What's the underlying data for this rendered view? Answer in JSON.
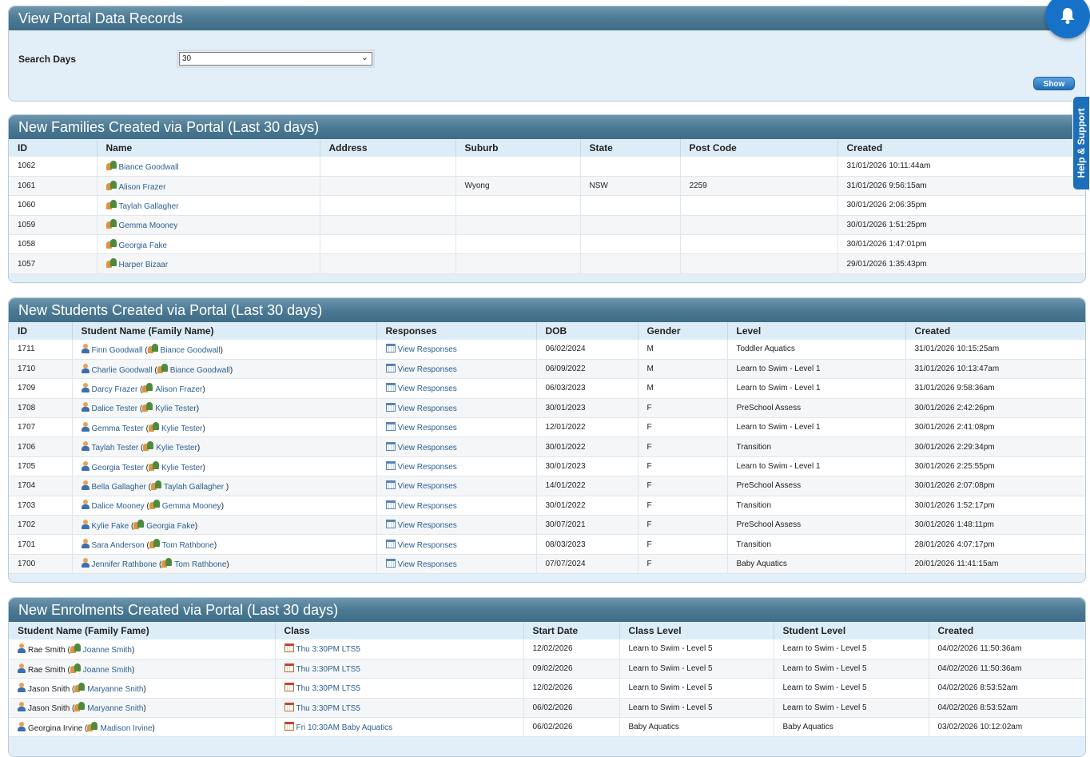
{
  "search_panel": {
    "title": "View Portal Data Records",
    "search_days_label": "Search Days",
    "search_days_value": "30",
    "show_label": "Show"
  },
  "help_tab": {
    "label": "Help & Support"
  },
  "families": {
    "title": "New Families Created via Portal (Last 30 days)",
    "headers": [
      "ID",
      "Name",
      "Address",
      "Suburb",
      "State",
      "Post Code",
      "Created"
    ],
    "rows": [
      {
        "id": "1062",
        "name": "Biance Goodwall",
        "address": "",
        "suburb": "",
        "state": "",
        "postcode": "",
        "created": "31/01/2026 10:11:44am"
      },
      {
        "id": "1061",
        "name": "Alison Frazer",
        "address": "",
        "suburb": "Wyong",
        "state": "NSW",
        "postcode": "2259",
        "created": "31/01/2026 9:56:15am"
      },
      {
        "id": "1060",
        "name": "Taylah Gallagher",
        "address": "",
        "suburb": "",
        "state": "",
        "postcode": "",
        "created": "30/01/2026 2:06:35pm"
      },
      {
        "id": "1059",
        "name": "Gemma Mooney",
        "address": "",
        "suburb": "",
        "state": "",
        "postcode": "",
        "created": "30/01/2026 1:51:25pm"
      },
      {
        "id": "1058",
        "name": "Georgia Fake",
        "address": "",
        "suburb": "",
        "state": "",
        "postcode": "",
        "created": "30/01/2026 1:47:01pm"
      },
      {
        "id": "1057",
        "name": "Harper Bizaar",
        "address": "",
        "suburb": "",
        "state": "",
        "postcode": "",
        "created": "29/01/2026 1:35:43pm"
      }
    ]
  },
  "students": {
    "title": "New Students Created via Portal (Last 30 days)",
    "headers": [
      "ID",
      "Student Name (Family Name)",
      "Responses",
      "DOB",
      "Gender",
      "Level",
      "Created"
    ],
    "responses_label": "View Responses",
    "rows": [
      {
        "id": "1711",
        "student": "Finn Goodwall",
        "family": "Biance Goodwall",
        "dob": "06/02/2024",
        "gender": "M",
        "level": "Toddler Aquatics",
        "created": "31/01/2026 10:15:25am"
      },
      {
        "id": "1710",
        "student": "Charlie Goodwall",
        "family": "Biance Goodwall",
        "dob": "06/09/2022",
        "gender": "M",
        "level": "Learn to Swim - Level 1",
        "created": "31/01/2026 10:13:47am"
      },
      {
        "id": "1709",
        "student": "Darcy Frazer",
        "family": "Alison Frazer",
        "dob": "06/03/2023",
        "gender": "M",
        "level": "Learn to Swim - Level 1",
        "created": "31/01/2026 9:58:36am"
      },
      {
        "id": "1708",
        "student": "Dalice Tester",
        "family": "Kylie Tester",
        "dob": "30/01/2023",
        "gender": "F",
        "level": "PreSchool Assess",
        "created": "30/01/2026 2:42:26pm"
      },
      {
        "id": "1707",
        "student": "Gemma Tester",
        "family": "Kylie Tester",
        "dob": "12/01/2022",
        "gender": "F",
        "level": "Learn to Swim - Level 1",
        "created": "30/01/2026 2:41:08pm"
      },
      {
        "id": "1706",
        "student": "Taylah Tester",
        "family": "Kylie Tester",
        "dob": "30/01/2022",
        "gender": "F",
        "level": "Transition",
        "created": "30/01/2026 2:29:34pm"
      },
      {
        "id": "1705",
        "student": "Georgia Tester",
        "family": "Kylie Tester",
        "dob": "30/01/2023",
        "gender": "F",
        "level": "Learn to Swim - Level 1",
        "created": "30/01/2026 2:25:55pm"
      },
      {
        "id": "1704",
        "student": "Bella Gallagher",
        "family": "Taylah Gallagher ",
        "dob": "14/01/2022",
        "gender": "F",
        "level": "PreSchool Assess",
        "created": "30/01/2026 2:07:08pm"
      },
      {
        "id": "1703",
        "student": "Dalice Mooney",
        "family": "Gemma Mooney",
        "dob": "30/01/2022",
        "gender": "F",
        "level": "Transition",
        "created": "30/01/2026 1:52:17pm"
      },
      {
        "id": "1702",
        "student": "Kylie Fake",
        "family": "Georgia Fake",
        "dob": "30/07/2021",
        "gender": "F",
        "level": "PreSchool Assess",
        "created": "30/01/2026 1:48:11pm"
      },
      {
        "id": "1701",
        "student": "Sara Anderson",
        "family": "Tom Rathbone",
        "dob": "08/03/2023",
        "gender": "F",
        "level": "Transition",
        "created": "28/01/2026 4:07:17pm"
      },
      {
        "id": "1700",
        "student": "Jennifer Rathbone",
        "family": "Tom Rathbone",
        "dob": "07/07/2024",
        "gender": "F",
        "level": "Baby Aquatics",
        "created": "20/01/2026 11:41:15am"
      }
    ]
  },
  "enrolments": {
    "title": "New Enrolments Created via Portal (Last 30 days)",
    "headers": [
      "Student Name (Family Fame)",
      "Class",
      "Start Date",
      "Class Level",
      "Student Level",
      "Created"
    ],
    "rows": [
      {
        "student": "Rae Smith",
        "family": "Joanne Smith",
        "class": "Thu 3:30PM LTS5",
        "start": "12/02/2026",
        "class_level": "Learn to Swim - Level 5",
        "student_level": "Learn to Swim - Level 5",
        "created": "04/02/2026 11:50:36am"
      },
      {
        "student": "Rae Smith",
        "family": "Joanne Smith",
        "class": "Thu 3:30PM LTS5",
        "start": "09/02/2026",
        "class_level": "Learn to Swim - Level 5",
        "student_level": "Learn to Swim - Level 5",
        "created": "04/02/2026 11:50:36am"
      },
      {
        "student": "Jason Snith",
        "family": "Maryanne Snith",
        "class": "Thu 3:30PM LTS5",
        "start": "12/02/2026",
        "class_level": "Learn to Swim - Level 5",
        "student_level": "Learn to Swim - Level 5",
        "created": "04/02/2026 8:53:52am"
      },
      {
        "student": "Jason Snith",
        "family": "Maryanne Snith",
        "class": "Thu 3:30PM LTS5",
        "start": "06/02/2026",
        "class_level": "Learn to Swim - Level 5",
        "student_level": "Learn to Swim - Level 5",
        "created": "04/02/2026 8:53:52am"
      },
      {
        "student": "Georgina Irvine",
        "family": "Madison Irvine",
        "class": "Fri 10:30AM Baby Aquatics",
        "start": "06/02/2026",
        "class_level": "Baby Aquatics",
        "student_level": "Baby Aquatics",
        "created": "03/02/2026 10:12:02am"
      }
    ]
  }
}
